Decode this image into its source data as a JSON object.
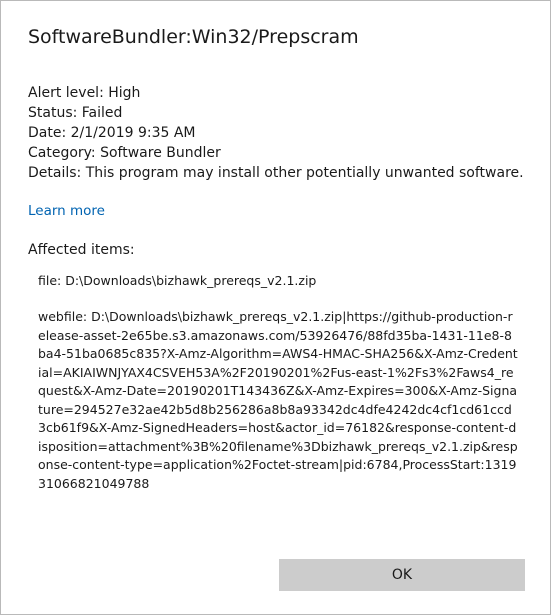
{
  "dialog": {
    "title": "SoftwareBundler:Win32/Prepscram",
    "properties": {
      "alert_level": "Alert level: High",
      "status": "Status: Failed",
      "date": "Date:  2/1/2019 9:35 AM",
      "category": "Category:  Software Bundler",
      "details": "Details:  This program may install other potentially unwanted software."
    },
    "learn_more_label": "Learn more",
    "affected_items_heading": "Affected items:",
    "affected_items": {
      "file": "file: D:\\Downloads\\bizhawk_prereqs_v2.1.zip",
      "webfile": "webfile: D:\\Downloads\\bizhawk_prereqs_v2.1.zip|https://github-production-release-asset-2e65be.s3.amazonaws.com/53926476/88fd35ba-1431-11e8-8ba4-51ba0685c835?X-Amz-Algorithm=AWS4-HMAC-SHA256&X-Amz-Credential=AKIAIWNJYAX4CSVEH53A%2F20190201%2Fus-east-1%2Fs3%2Faws4_request&X-Amz-Date=20190201T143436Z&X-Amz-Expires=300&X-Amz-Signature=294527e32ae42b5d8b256286a8b8a93342dc4dfe4242dc4cf1cd61ccd3cb61f9&X-Amz-SignedHeaders=host&actor_id=76182&response-content-disposition=attachment%3B%20filename%3Dbizhawk_prereqs_v2.1.zip&response-content-type=application%2Foctet-stream|pid:6784,ProcessStart:131931066821049788"
    },
    "ok_label": "OK"
  },
  "colors": {
    "link": "#0063b1",
    "button_bg": "#cccccc",
    "text": "#1a1a1a",
    "border": "#b9b9b9"
  }
}
